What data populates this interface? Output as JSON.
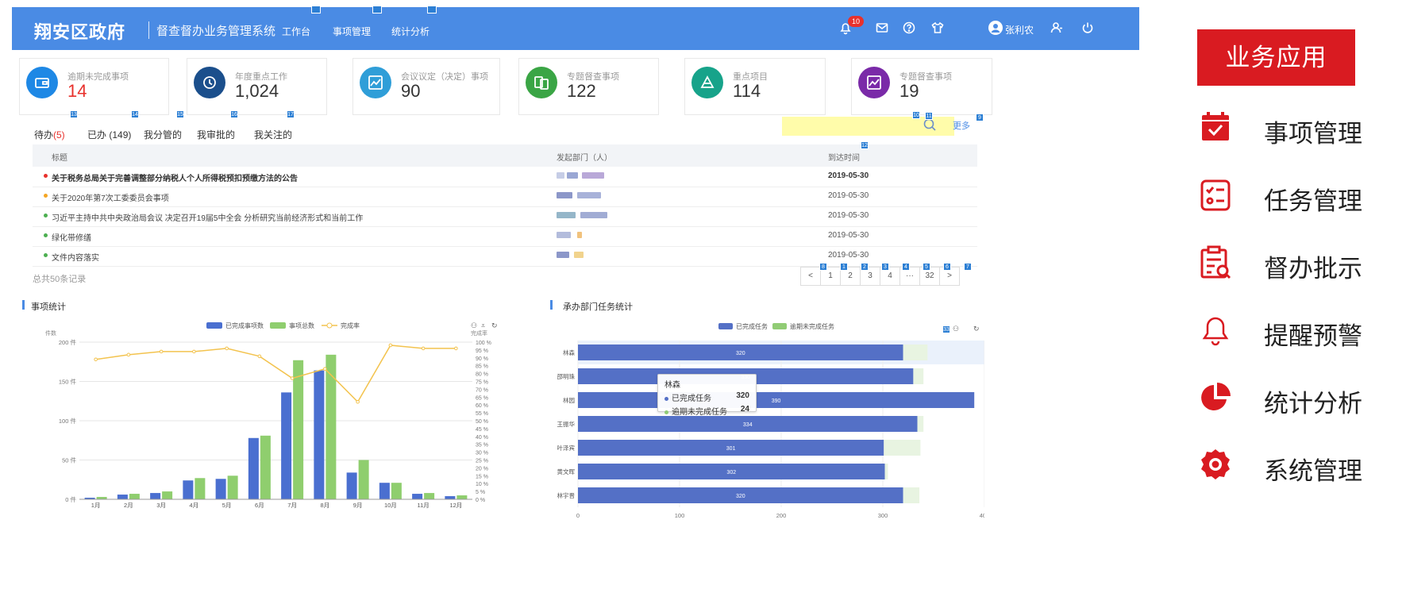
{
  "header": {
    "brand": "翔安区政府",
    "subtitle": "督查督办业务管理系统",
    "nav": [
      "工作台",
      "事项管理",
      "统计分析"
    ],
    "notification_count": "10",
    "user": "张利农"
  },
  "stats": [
    {
      "label": "逾期未完成事项",
      "value": "14",
      "color": "#1e88e5",
      "value_color": "#e8312c"
    },
    {
      "label": "年度重点工作",
      "value": "1,024",
      "color": "#1b4f8c"
    },
    {
      "label": "会议议定（决定）事项",
      "value": "90",
      "color": "#2f9ed8"
    },
    {
      "label": "专题督查事项",
      "value": "122",
      "color": "#3aa545"
    },
    {
      "label": "重点项目",
      "value": "114",
      "color": "#17a38a"
    },
    {
      "label": "专题督查事项",
      "value": "19",
      "color": "#7a2aa8"
    }
  ],
  "tabs": [
    {
      "label": "待办",
      "count": "(5)"
    },
    {
      "label": "已办",
      "count": "(149)"
    },
    {
      "label": "我分管的",
      "count": ""
    },
    {
      "label": "我审批的",
      "count": ""
    },
    {
      "label": "我关注的",
      "count": ""
    }
  ],
  "more": "更多",
  "table": {
    "headers": [
      "标题",
      "发起部门（人）",
      "到达时间"
    ],
    "rows": [
      {
        "title": "关于税务总局关于完善调整部分纳税人个人所得税预扣预缴方法的公告",
        "date": "2019-05-30",
        "dot": "#e8312c",
        "bold": true
      },
      {
        "title": "关于2020年第7次工委委员会事项",
        "date": "2019-05-30",
        "dot": "#f5a623",
        "bold": false
      },
      {
        "title": "习近平主持中共中央政治局会议 决定召开19届5中全会 分析研究当前经济形式和当前工作",
        "date": "2019-05-30",
        "dot": "#4caf50",
        "bold": false
      },
      {
        "title": "绿化带修缮",
        "date": "2019-05-30",
        "dot": "#4caf50",
        "bold": false
      },
      {
        "title": "文件内容落实",
        "date": "2019-05-30",
        "dot": "#4caf50",
        "bold": false
      }
    ],
    "total": "总共50条记录",
    "pages": [
      "<",
      "1",
      "2",
      "3",
      "4",
      "···",
      "32",
      ">"
    ]
  },
  "markers": [
    "13",
    "14",
    "15",
    "16",
    "17",
    "10",
    "11",
    "9",
    "12",
    "8",
    "1",
    "2",
    "3",
    "4",
    "5",
    "6",
    "7",
    "33"
  ],
  "charts": {
    "left_title": "事项统计",
    "right_title": "承办部门任务统计"
  },
  "tooltip": {
    "name": "林森",
    "rows": [
      {
        "label": "已完成任务",
        "value": "320"
      },
      {
        "label": "逾期未完成任务",
        "value": "24"
      }
    ]
  },
  "chart_data": [
    {
      "type": "bar",
      "title": "事项统计",
      "categories": [
        "1月",
        "2月",
        "3月",
        "4月",
        "5月",
        "6月",
        "7月",
        "8月",
        "9月",
        "10月",
        "11月",
        "12月"
      ],
      "series": [
        {
          "name": "已完成事项数",
          "type": "bar",
          "color": "#4a6fd0",
          "values": [
            2,
            6,
            8,
            24,
            26,
            78,
            136,
            164,
            34,
            21,
            7,
            4
          ]
        },
        {
          "name": "事项总数",
          "type": "bar",
          "color": "#8fce6e",
          "values": [
            3,
            7,
            10,
            27,
            30,
            81,
            177,
            184,
            50,
            21,
            8,
            5
          ]
        },
        {
          "name": "完成率",
          "type": "line",
          "color": "#f3c34e",
          "values": [
            89,
            92,
            94,
            94,
            96,
            91,
            77,
            83,
            62,
            98,
            96,
            96
          ]
        }
      ],
      "ylabel": "件数",
      "y2label": "完成率",
      "ylim": [
        0,
        200
      ],
      "y2lim": [
        0,
        100
      ],
      "yticks": [
        "0 件",
        "50 件",
        "100 件",
        "150 件",
        "200 件"
      ],
      "y2ticks": [
        "0 %",
        "5 %",
        "10 %",
        "15 %",
        "20 %",
        "25 %",
        "30 %",
        "35 %",
        "40 %",
        "45 %",
        "50 %",
        "55 %",
        "60 %",
        "65 %",
        "70 %",
        "75 %",
        "80 %",
        "85 %",
        "90 %",
        "95 %",
        "100 %"
      ],
      "legend": "top-center",
      "grid": true
    },
    {
      "type": "bar",
      "orientation": "horizontal",
      "title": "承办部门任务统计",
      "categories": [
        "林森",
        "邵明珠",
        "林园",
        "王振华",
        "叶泽宾",
        "黄文晖",
        "林宇晋"
      ],
      "series": [
        {
          "name": "已完成任务",
          "color": "#5470c6",
          "values": [
            320,
            330,
            390,
            334,
            301,
            302,
            320
          ]
        },
        {
          "name": "逾期未完成任务",
          "color": "#91cc75",
          "values": [
            24,
            10,
            0,
            6,
            36,
            3,
            16
          ]
        }
      ],
      "xlim": [
        0,
        400
      ],
      "xticks": [
        "0",
        "100",
        "200",
        "300",
        "400"
      ],
      "legend": "top-center",
      "grid": true
    }
  ],
  "side_menu": {
    "title": "业务应用",
    "items": [
      {
        "label": "事项管理",
        "icon": "calendar-check-icon"
      },
      {
        "label": "任务管理",
        "icon": "checklist-icon"
      },
      {
        "label": "督办批示",
        "icon": "clipboard-search-icon"
      },
      {
        "label": "提醒预警",
        "icon": "bell-icon"
      },
      {
        "label": "统计分析",
        "icon": "pie-chart-icon"
      },
      {
        "label": "系统管理",
        "icon": "gear-icon"
      }
    ],
    "accent": "#d91b21"
  }
}
